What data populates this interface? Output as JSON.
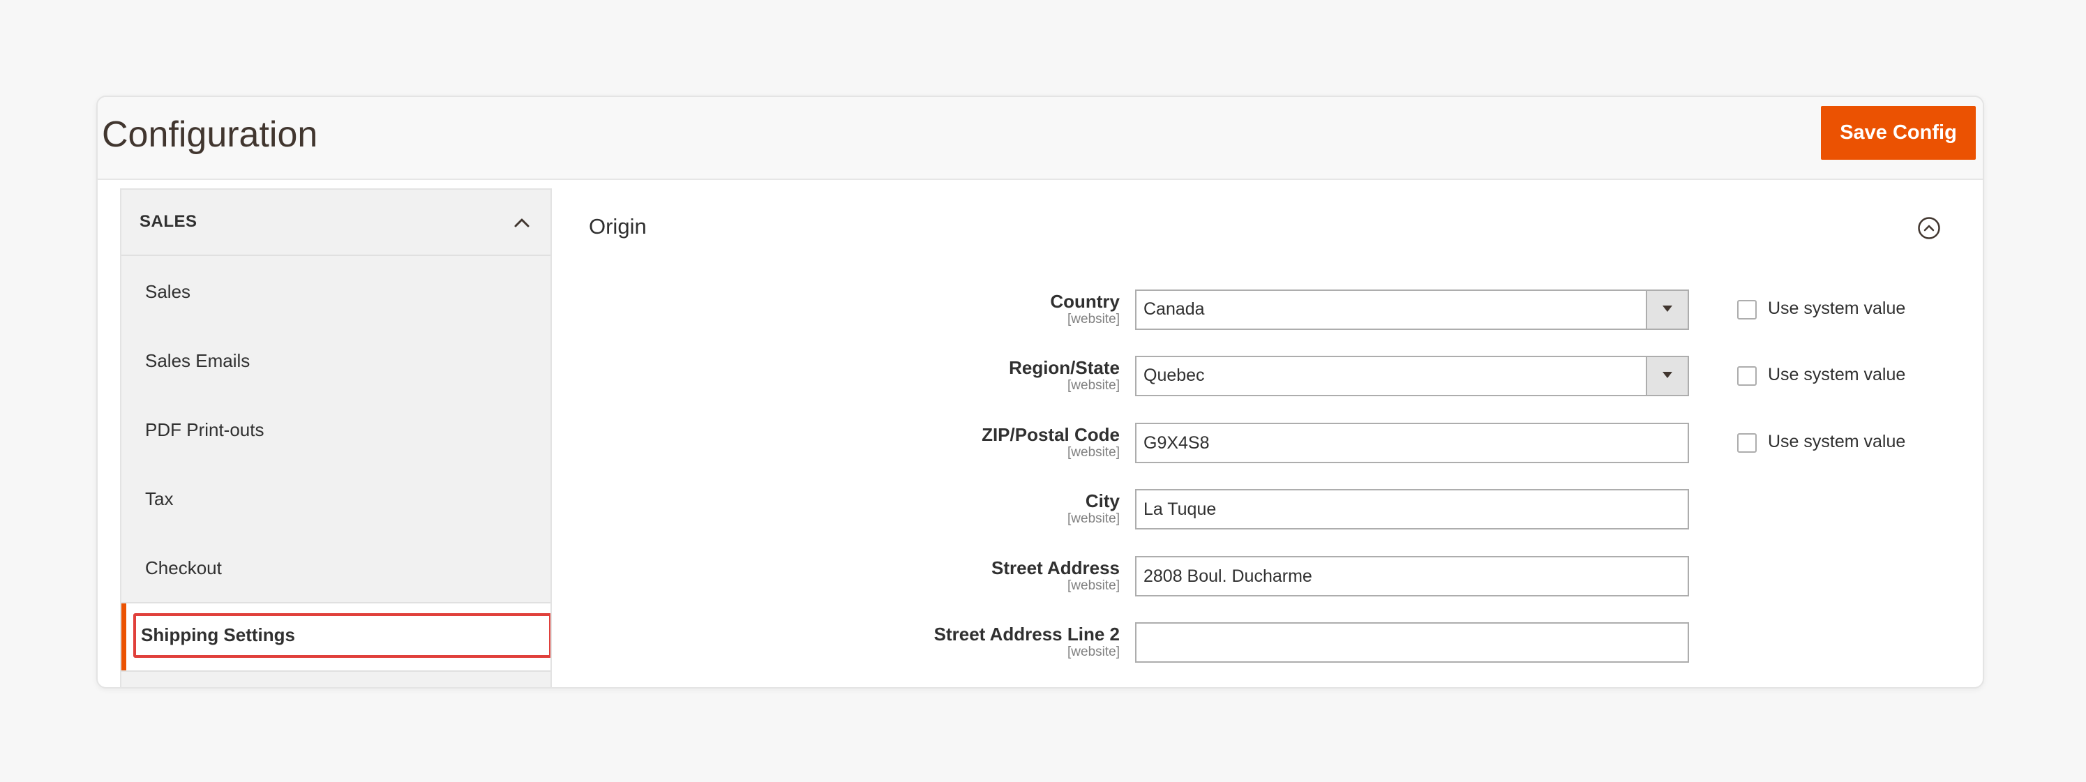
{
  "header": {
    "title": "Configuration",
    "save_label": "Save Config",
    "accent_color": "#eb5202"
  },
  "sidebar": {
    "section_label": "SALES",
    "items": [
      {
        "label": "Sales",
        "active": false
      },
      {
        "label": "Sales Emails",
        "active": false
      },
      {
        "label": "PDF Print-outs",
        "active": false
      },
      {
        "label": "Tax",
        "active": false
      },
      {
        "label": "Checkout",
        "active": false
      },
      {
        "label": "Shipping Settings",
        "active": true
      }
    ]
  },
  "origin": {
    "title": "Origin",
    "fields": [
      {
        "label": "Country",
        "scope": "[website]",
        "type": "select",
        "value": "Canada",
        "use_system_value": "Use system value"
      },
      {
        "label": "Region/State",
        "scope": "[website]",
        "type": "select",
        "value": "Quebec",
        "use_system_value": "Use system value"
      },
      {
        "label": "ZIP/Postal Code",
        "scope": "[website]",
        "type": "text",
        "value": "G9X4S8",
        "use_system_value": "Use system value"
      },
      {
        "label": "City",
        "scope": "[website]",
        "type": "text",
        "value": "La Tuque"
      },
      {
        "label": "Street Address",
        "scope": "[website]",
        "type": "text",
        "value": "2808 Boul. Ducharme"
      },
      {
        "label": "Street Address Line 2",
        "scope": "[website]",
        "type": "text",
        "value": ""
      }
    ]
  }
}
